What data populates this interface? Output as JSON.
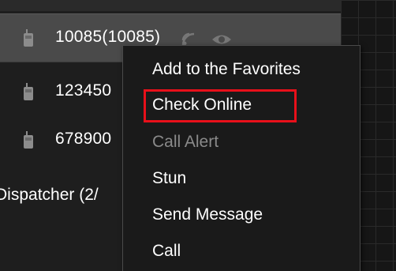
{
  "device_list": {
    "rows": [
      {
        "label": "10085(10085)",
        "selected": true,
        "icon": "radio-handset-icon"
      },
      {
        "label": "123450",
        "selected": false,
        "icon": "radio-handset-icon"
      },
      {
        "label": "678900",
        "selected": false,
        "icon": "radio-handset-icon"
      }
    ],
    "group_label": "Dispatcher (2/",
    "state_icons": [
      "signal-icon",
      "eye-icon"
    ]
  },
  "context_menu": {
    "items": [
      {
        "label": "Add to the Favorites",
        "enabled": true
      },
      {
        "label": "Check Online",
        "enabled": true,
        "highlighted": true
      },
      {
        "label": "Call Alert",
        "enabled": false
      },
      {
        "label": "Stun",
        "enabled": true
      },
      {
        "label": "Send Message",
        "enabled": true
      },
      {
        "label": "Call",
        "enabled": true
      }
    ],
    "highlight_color": "#e8101a"
  },
  "colors": {
    "background": "#1b1b1b",
    "selected_row": "#4a4a4a",
    "text": "#ffffff",
    "disabled_text": "#8a8a8a"
  }
}
